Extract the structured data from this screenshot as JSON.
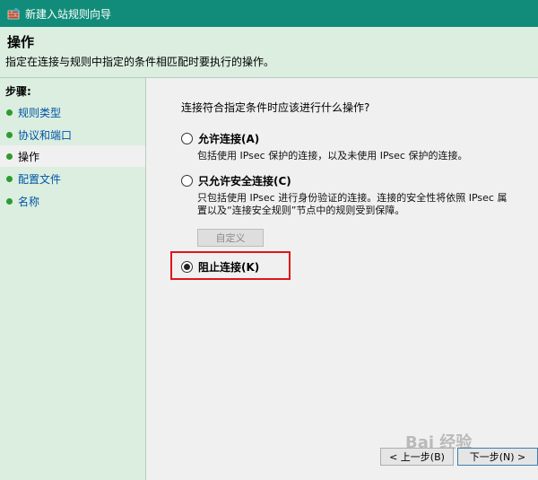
{
  "window": {
    "title": "新建入站规则向导"
  },
  "header": {
    "title": "操作",
    "description": "指定在连接与规则中指定的条件相匹配时要执行的操作。"
  },
  "sidebar": {
    "steps_label": "步骤:",
    "items": [
      {
        "label": "规则类型"
      },
      {
        "label": "协议和端口"
      },
      {
        "label": "操作"
      },
      {
        "label": "配置文件"
      },
      {
        "label": "名称"
      }
    ]
  },
  "main": {
    "question": "连接符合指定条件时应该进行什么操作?",
    "options": [
      {
        "label": "允许连接(A)",
        "description": [
          "包括使用 IPsec 保护的连接，以及未使用 IPsec 保护的连接。"
        ],
        "checked": false
      },
      {
        "label": "只允许安全连接(C)",
        "description": [
          "只包括使用 IPsec 进行身份验证的连接。连接的安全性将依照 IPsec 属",
          "置以及“连接安全规则”节点中的规则受到保障。"
        ],
        "checked": false
      },
      {
        "label": "阻止连接(K)",
        "description": [],
        "checked": true
      }
    ],
    "custom_button": "自定义"
  },
  "footer": {
    "back_button": "< 上一步(B)",
    "next_button": "下一步(N) >"
  },
  "watermark": "Bai 经验",
  "colors": {
    "titlebar": "#128c7a",
    "panel": "#dbeee0",
    "link": "#0054a6",
    "bullet": "#2e9b2e",
    "highlight": "#e0141c"
  }
}
